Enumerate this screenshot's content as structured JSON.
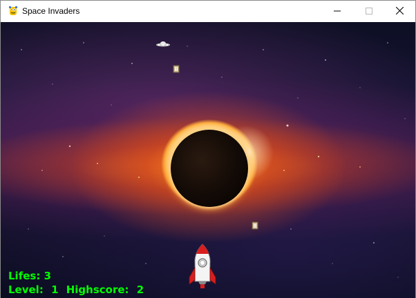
{
  "window": {
    "title": "Space Invaders",
    "controls": [
      "minimize",
      "maximize",
      "close"
    ]
  },
  "icons": {
    "app": "pygame-snake-icon",
    "minimize": "minimize-icon",
    "maximize": "maximize-icon",
    "close": "close-icon",
    "player": "rocket-icon",
    "enemy_ship": "alien-saucer-icon",
    "bullet": "enemy-bullet-icon"
  },
  "hud": {
    "lives_label": "Lifes:",
    "lives_value": "3",
    "level_label": "Level:",
    "level_value": "1",
    "highscore_label": "Highscore:",
    "highscore_value": "2",
    "color": "#00ff00"
  },
  "colors": {
    "hud_text": "#00ff00",
    "rocket_body": "#ffffff",
    "rocket_accent": "#d81e1e"
  }
}
